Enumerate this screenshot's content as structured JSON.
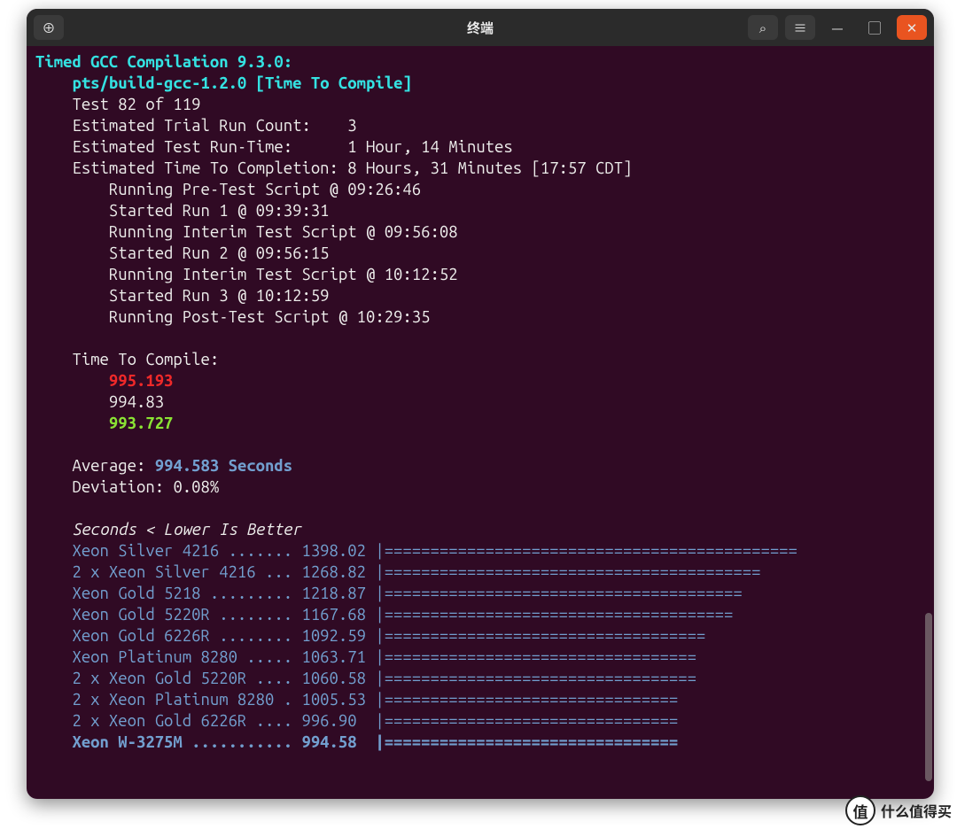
{
  "window": {
    "title": "终端"
  },
  "titlebar": {
    "newtab_glyph": "⊕",
    "search_glyph": "⌕",
    "menu_glyph": "≡",
    "min_glyph": "—",
    "max_glyph": "▢",
    "close_glyph": "✕"
  },
  "header": {
    "title_prefix": "Timed GCC Compilation 9.3.0:",
    "ident": "pts/build-gcc-1.2.0",
    "metric": "[Time To Compile]"
  },
  "test": {
    "progress_label": "Test 82 of 119",
    "etrc_label": "Estimated Trial Run Count:",
    "etrc_value": "3",
    "ert_label": "Estimated Test Run-Time:",
    "ert_value": "1 Hour, 14 Minutes",
    "etc_label": "Estimated Time To Completion:",
    "etc_value": "8 Hours, 31 Minutes [17:57 CDT]"
  },
  "runs": [
    "Running Pre-Test Script @ 09:26:46",
    "Started Run 1 @ 09:39:31",
    "Running Interim Test Script @ 09:56:08",
    "Started Run 2 @ 09:56:15",
    "Running Interim Test Script @ 10:12:52",
    "Started Run 3 @ 10:12:59",
    "Running Post-Test Script @ 10:29:35"
  ],
  "times": {
    "label": "Time To Compile:",
    "v1": "995.193",
    "v2": "994.83",
    "v3": "993.727"
  },
  "summary": {
    "avg_label": "Average:",
    "avg_value": "994.583 Seconds",
    "dev_label": "Deviation:",
    "dev_value": "0.08%"
  },
  "legend": "Seconds < Lower Is Better",
  "comparison": [
    {
      "name": "Xeon Silver 4216",
      "dots": ".......",
      "value": "1398.02",
      "bar": "============================================="
    },
    {
      "name": "2 x Xeon Silver 4216",
      "dots": "...",
      "value": "1268.82",
      "bar": "========================================="
    },
    {
      "name": "Xeon Gold 5218",
      "dots": ".........",
      "value": "1218.87",
      "bar": "======================================="
    },
    {
      "name": "Xeon Gold 5220R",
      "dots": "........",
      "value": "1167.68",
      "bar": "======================================"
    },
    {
      "name": "Xeon Gold 6226R",
      "dots": "........",
      "value": "1092.59",
      "bar": "==================================="
    },
    {
      "name": "Xeon Platinum 8280",
      "dots": ".....",
      "value": "1063.71",
      "bar": "=================================="
    },
    {
      "name": "2 x Xeon Gold 5220R",
      "dots": "....",
      "value": "1060.58",
      "bar": "=================================="
    },
    {
      "name": "2 x Xeon Platinum 8280",
      "dots": ".",
      "value": "1005.53",
      "bar": "================================"
    },
    {
      "name": "2 x Xeon Gold 6226R",
      "dots": "....",
      "value": "996.90",
      "bar": "================================"
    },
    {
      "name": "Xeon W-3275M",
      "dots": "...........",
      "value": "994.58",
      "bar": "================================",
      "highlight": true
    }
  ],
  "chart_data": {
    "type": "bar",
    "title": "Timed GCC Compilation 9.3.0 — Time To Compile",
    "xlabel": "",
    "ylabel": "Seconds (Lower Is Better)",
    "ylim": [
      0,
      1400
    ],
    "categories": [
      "Xeon Silver 4216",
      "2 x Xeon Silver 4216",
      "Xeon Gold 5218",
      "Xeon Gold 5220R",
      "Xeon Gold 6226R",
      "Xeon Platinum 8280",
      "2 x Xeon Gold 5220R",
      "2 x Xeon Platinum 8280",
      "2 x Xeon Gold 6226R",
      "Xeon W-3275M"
    ],
    "values": [
      1398.02,
      1268.82,
      1218.87,
      1167.68,
      1092.59,
      1063.71,
      1060.58,
      1005.53,
      996.9,
      994.58
    ]
  },
  "watermark": {
    "glyph": "值",
    "text": "什么值得买"
  }
}
